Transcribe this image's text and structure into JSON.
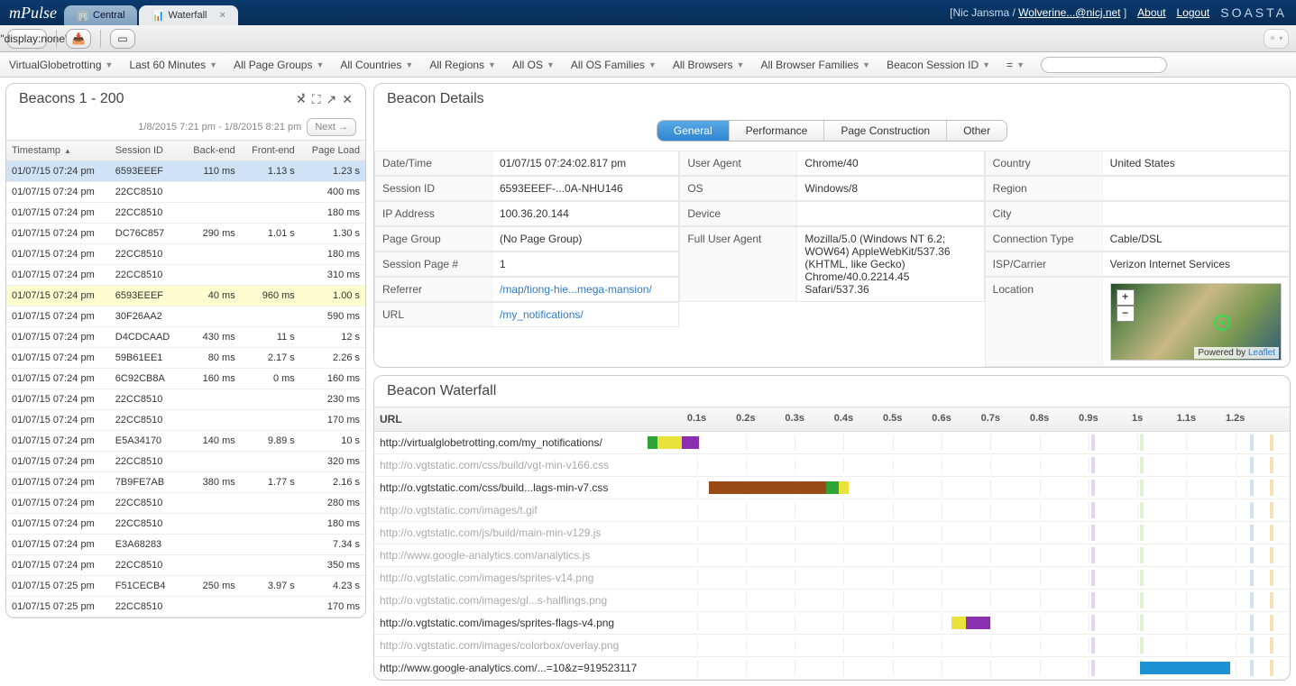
{
  "app": {
    "name": "mPulse",
    "brand": "SOASTA"
  },
  "tabs": [
    {
      "label": "Central",
      "active": false,
      "closable": false
    },
    {
      "label": "Waterfall",
      "active": true,
      "closable": true
    }
  ],
  "top_right": {
    "user_prefix": "[Nic Jansma / ",
    "user_link": "Wolverine...@nicj.net",
    "user_suffix": " ]",
    "about": "About",
    "logout": "Logout"
  },
  "filters": {
    "items": [
      "VirtualGlobetrotting",
      "Last 60 Minutes",
      "All Page Groups",
      "All Countries",
      "All Regions",
      "All OS",
      "All OS Families",
      "All Browsers",
      "All Browser Families",
      "Beacon Session ID",
      "="
    ],
    "search_placeholder": ""
  },
  "beacons_panel": {
    "title": "Beacons 1 - 200",
    "range": "1/8/2015 7:21 pm - 1/8/2015 8:21 pm",
    "next": "Next →",
    "headers": {
      "timestamp": "Timestamp",
      "session": "Session ID",
      "backend": "Back-end",
      "frontend": "Front-end",
      "pageload": "Page Load"
    },
    "rows": [
      {
        "ts": "01/07/15 07:24 pm",
        "sid": "6593EEEF",
        "be": "110 ms",
        "fe": "1.13 s",
        "pl": "1.23 s",
        "sel": true
      },
      {
        "ts": "01/07/15 07:24 pm",
        "sid": "22CC8510",
        "be": "",
        "fe": "",
        "pl": "400 ms"
      },
      {
        "ts": "01/07/15 07:24 pm",
        "sid": "22CC8510",
        "be": "",
        "fe": "",
        "pl": "180 ms"
      },
      {
        "ts": "01/07/15 07:24 pm",
        "sid": "DC76C857",
        "be": "290 ms",
        "fe": "1.01 s",
        "pl": "1.30 s"
      },
      {
        "ts": "01/07/15 07:24 pm",
        "sid": "22CC8510",
        "be": "",
        "fe": "",
        "pl": "180 ms"
      },
      {
        "ts": "01/07/15 07:24 pm",
        "sid": "22CC8510",
        "be": "",
        "fe": "",
        "pl": "310 ms"
      },
      {
        "ts": "01/07/15 07:24 pm",
        "sid": "6593EEEF",
        "be": "40 ms",
        "fe": "960 ms",
        "pl": "1.00 s",
        "hl": true
      },
      {
        "ts": "01/07/15 07:24 pm",
        "sid": "30F26AA2",
        "be": "",
        "fe": "",
        "pl": "590 ms"
      },
      {
        "ts": "01/07/15 07:24 pm",
        "sid": "D4CDCAAD",
        "be": "430 ms",
        "fe": "11 s",
        "pl": "12 s"
      },
      {
        "ts": "01/07/15 07:24 pm",
        "sid": "59B61EE1",
        "be": "80 ms",
        "fe": "2.17 s",
        "pl": "2.26 s"
      },
      {
        "ts": "01/07/15 07:24 pm",
        "sid": "6C92CB8A",
        "be": "160 ms",
        "fe": "0 ms",
        "pl": "160 ms"
      },
      {
        "ts": "01/07/15 07:24 pm",
        "sid": "22CC8510",
        "be": "",
        "fe": "",
        "pl": "230 ms"
      },
      {
        "ts": "01/07/15 07:24 pm",
        "sid": "22CC8510",
        "be": "",
        "fe": "",
        "pl": "170 ms"
      },
      {
        "ts": "01/07/15 07:24 pm",
        "sid": "E5A34170",
        "be": "140 ms",
        "fe": "9.89 s",
        "pl": "10 s"
      },
      {
        "ts": "01/07/15 07:24 pm",
        "sid": "22CC8510",
        "be": "",
        "fe": "",
        "pl": "320 ms"
      },
      {
        "ts": "01/07/15 07:24 pm",
        "sid": "7B9FE7AB",
        "be": "380 ms",
        "fe": "1.77 s",
        "pl": "2.16 s"
      },
      {
        "ts": "01/07/15 07:24 pm",
        "sid": "22CC8510",
        "be": "",
        "fe": "",
        "pl": "280 ms"
      },
      {
        "ts": "01/07/15 07:24 pm",
        "sid": "22CC8510",
        "be": "",
        "fe": "",
        "pl": "180 ms"
      },
      {
        "ts": "01/07/15 07:24 pm",
        "sid": "E3A68283",
        "be": "",
        "fe": "",
        "pl": "7.34 s"
      },
      {
        "ts": "01/07/15 07:24 pm",
        "sid": "22CC8510",
        "be": "",
        "fe": "",
        "pl": "350 ms"
      },
      {
        "ts": "01/07/15 07:25 pm",
        "sid": "F51CECB4",
        "be": "250 ms",
        "fe": "3.97 s",
        "pl": "4.23 s"
      },
      {
        "ts": "01/07/15 07:25 pm",
        "sid": "22CC8510",
        "be": "",
        "fe": "",
        "pl": "170 ms"
      }
    ]
  },
  "details_panel": {
    "title": "Beacon Details",
    "segments": [
      "General",
      "Performance",
      "Page Construction",
      "Other"
    ],
    "active_segment": 0,
    "col1": [
      {
        "k": "Date/Time",
        "v": "01/07/15 07:24:02.817 pm"
      },
      {
        "k": "Session ID",
        "v": "6593EEEF-...0A-NHU146"
      },
      {
        "k": "IP Address",
        "v": "100.36.20.144"
      },
      {
        "k": "Page Group",
        "v": "(No Page Group)"
      },
      {
        "k": "Session Page #",
        "v": "1"
      },
      {
        "k": "Referrer",
        "v": "/map/tiong-hie...mega-mansion/",
        "link": true
      },
      {
        "k": "URL",
        "v": "/my_notifications/",
        "link": true
      }
    ],
    "col2": [
      {
        "k": "User Agent",
        "v": "Chrome/40"
      },
      {
        "k": "OS",
        "v": "Windows/8"
      },
      {
        "k": "Device",
        "v": ""
      },
      {
        "k": "Full User Agent",
        "v": "Mozilla/5.0 (Windows NT 6.2; WOW64) AppleWebKit/537.36 (KHTML, like Gecko) Chrome/40.0.2214.45 Safari/537.36"
      }
    ],
    "col3": [
      {
        "k": "Country",
        "v": "United States"
      },
      {
        "k": "Region",
        "v": ""
      },
      {
        "k": "City",
        "v": ""
      },
      {
        "k": "Connection Type",
        "v": "Cable/DSL"
      },
      {
        "k": "ISP/Carrier",
        "v": "Verizon Internet Services"
      },
      {
        "k": "Location",
        "v": "",
        "map": true
      }
    ],
    "map_attr_prefix": "Powered by ",
    "map_attr_link": "Leaflet"
  },
  "waterfall_panel": {
    "title": "Beacon Waterfall",
    "url_header": "URL",
    "ticks": [
      "0.1s",
      "0.2s",
      "0.3s",
      "0.4s",
      "0.5s",
      "0.6s",
      "0.7s",
      "0.8s",
      "0.9s",
      "1s",
      "1.1s",
      "1.2s"
    ],
    "rows": [
      {
        "url": "http://virtualglobetrotting.com/my_notifications/",
        "dim": false
      },
      {
        "url": "http://o.vgtstatic.com/css/build/vgt-min-v166.css",
        "dim": true
      },
      {
        "url": "http://o.vgtstatic.com/css/build...lags-min-v7.css",
        "dim": false
      },
      {
        "url": "http://o.vgtstatic.com/images/t.gif",
        "dim": true
      },
      {
        "url": "http://o.vgtstatic.com/js/build/main-min-v129.js",
        "dim": true
      },
      {
        "url": "http://www.google-analytics.com/analytics.js",
        "dim": true
      },
      {
        "url": "http://o.vgtstatic.com/images/sprites-v14.png",
        "dim": true
      },
      {
        "url": "http://o.vgtstatic.com/images/gl...s-halflings.png",
        "dim": true
      },
      {
        "url": "http://o.vgtstatic.com/images/sprites-flags-v4.png",
        "dim": false
      },
      {
        "url": "http://o.vgtstatic.com/images/colorbox/overlay.png",
        "dim": true
      },
      {
        "url": "http://www.google-analytics.com/...=10&z=919523117",
        "dim": false
      }
    ]
  },
  "chart_data": {
    "type": "gantt",
    "x_unit": "seconds",
    "xlim": [
      0,
      1.3
    ],
    "ticks": [
      0.1,
      0.2,
      0.3,
      0.4,
      0.5,
      0.6,
      0.7,
      0.8,
      0.9,
      1.0,
      1.1,
      1.2
    ],
    "guides": [
      {
        "x": 0.905,
        "color": "#c9a7e6"
      },
      {
        "x": 1.005,
        "color": "#bfe5a6"
      },
      {
        "x": 1.23,
        "color": "#9ec8e8"
      },
      {
        "x": 1.27,
        "color": "#f0c36d"
      }
    ],
    "rows": [
      {
        "url": "http://virtualglobetrotting.com/my_notifications/",
        "segments": [
          {
            "start": 0.0,
            "end": 0.02,
            "color": "#2fa336"
          },
          {
            "start": 0.02,
            "end": 0.07,
            "color": "#e9e23a"
          },
          {
            "start": 0.07,
            "end": 0.105,
            "color": "#8a2fb0"
          }
        ]
      },
      {
        "url": "http://o.vgtstatic.com/css/build/vgt-min-v166.css",
        "segments": []
      },
      {
        "url": "http://o.vgtstatic.com/css/build...lags-min-v7.css",
        "segments": [
          {
            "start": 0.125,
            "end": 0.365,
            "color": "#9a4a16"
          },
          {
            "start": 0.365,
            "end": 0.39,
            "color": "#2fa336"
          },
          {
            "start": 0.39,
            "end": 0.41,
            "color": "#e9e23a"
          }
        ]
      },
      {
        "url": "http://o.vgtstatic.com/images/t.gif",
        "segments": []
      },
      {
        "url": "http://o.vgtstatic.com/js/build/main-min-v129.js",
        "segments": []
      },
      {
        "url": "http://www.google-analytics.com/analytics.js",
        "segments": []
      },
      {
        "url": "http://o.vgtstatic.com/images/sprites-v14.png",
        "segments": []
      },
      {
        "url": "http://o.vgtstatic.com/images/gl...s-halflings.png",
        "segments": []
      },
      {
        "url": "http://o.vgtstatic.com/images/sprites-flags-v4.png",
        "segments": [
          {
            "start": 0.62,
            "end": 0.65,
            "color": "#e9e23a"
          },
          {
            "start": 0.65,
            "end": 0.7,
            "color": "#8a2fb0"
          }
        ]
      },
      {
        "url": "http://o.vgtstatic.com/images/colorbox/overlay.png",
        "segments": []
      },
      {
        "url": "http://www.google-analytics.com/...=10&z=919523117",
        "segments": [
          {
            "start": 1.005,
            "end": 1.19,
            "color": "#1e90d4"
          }
        ]
      }
    ]
  }
}
